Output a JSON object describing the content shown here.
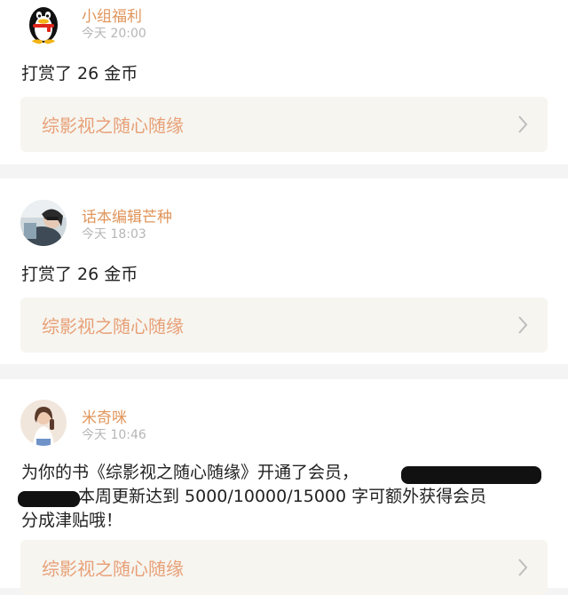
{
  "feed": [
    {
      "username": "小组福利",
      "time": "今天 20:00",
      "message": "打赏了 26 金币",
      "book_title": "综影视之随心随缘",
      "avatar_icon": "qq-penguin-avatar"
    },
    {
      "username": "话本编辑芒种",
      "time": "今天 18:03",
      "message": "打赏了 26 金币",
      "book_title": "综影视之随心随缘",
      "avatar_icon": "photo-avatar"
    },
    {
      "username": "米奇咪",
      "time": "今天 10:46",
      "message_lines": [
        "为你的书《综影视之随心随缘》开通了会员，",
        "本周更新达到 5000/10000/15000 字可额外获得会员",
        "分成津贴哦！"
      ],
      "book_title": "综影视之随心随缘",
      "avatar_icon": "photo-avatar"
    }
  ],
  "colors": {
    "username": "#e0945a",
    "book_title": "#e8a077",
    "time": "#b6b6b6",
    "link_bg": "#f6f5f0",
    "separator": "#f4f4f4"
  }
}
